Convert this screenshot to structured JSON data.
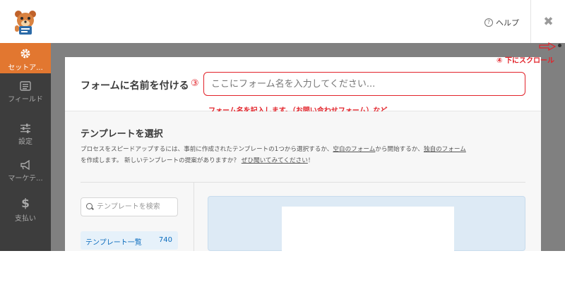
{
  "header": {
    "help_label": "ヘルプ",
    "help_icon": "question-circle-icon",
    "close_icon": "close-x-icon",
    "logo_icon": "mascot-bear-logo-icon"
  },
  "sidebar": {
    "items": [
      {
        "label": "セットア...",
        "icon": "gear-icon",
        "active": true
      },
      {
        "label": "フィールド",
        "icon": "fields-list-icon",
        "active": false
      },
      {
        "label": "設定",
        "icon": "sliders-icon",
        "active": false
      },
      {
        "label": "マーケテ...",
        "icon": "megaphone-icon",
        "active": false
      },
      {
        "label": "支払い",
        "icon": "dollar-icon",
        "active": false
      }
    ]
  },
  "form_name": {
    "label": "フォームに名前を付ける",
    "step_marker": "③",
    "placeholder": "ここにフォーム名を入力してください...",
    "note": "フォーム名を記入します。（お問い合わせフォーム）など"
  },
  "templates": {
    "title": "テンプレートを選択",
    "desc_part1": "プロセスをスピードアップするには、事前に作成されたテンプレートの1つから選択するか、",
    "desc_link1": "空白のフォーム",
    "desc_part2": "から開始するか、",
    "desc_link2": "独自のフォーム",
    "desc_part3": "を作成します。 新しいテンプレートの提案がありますか？",
    "desc_link3": "ぜひ聞いてみてください",
    "desc_part4": "！",
    "search_placeholder": "テンプレートを検索",
    "list_label": "テンプレート一覧",
    "list_count": "740"
  },
  "annotation": {
    "scroll_note": "④ 下にスクロール"
  },
  "colors": {
    "accent": "#e27730",
    "annotation_red": "#e2232a",
    "sidebar_bg": "#3d3d3d",
    "overlay": "#808080",
    "link_blue": "#0b6cbd"
  }
}
